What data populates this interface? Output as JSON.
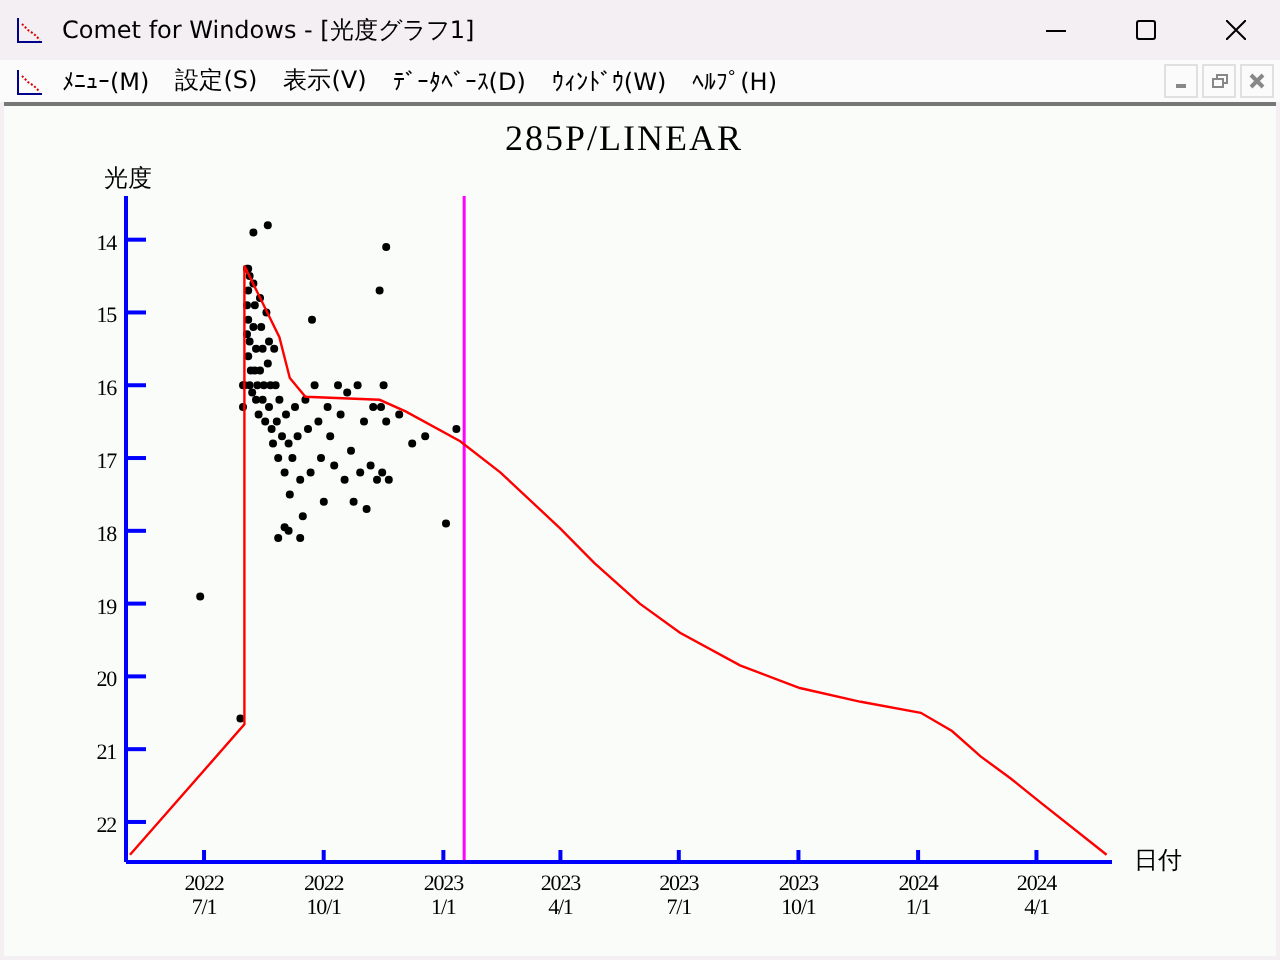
{
  "window": {
    "title": "Comet for Windows - [光度グラフ1]"
  },
  "menu": [
    "ﾒﾆｭｰ(M)",
    "設定(S)",
    "表示(V)",
    "ﾃﾞｰﾀﾍﾞｰｽ(D)",
    "ｳｨﾝﾄﾞｳ(W)",
    "ﾍﾙﾌﾟ(H)"
  ],
  "graph": {
    "chart_data": {
      "type": "scatter",
      "title": "285P/LINEAR",
      "xlabel": "日付",
      "ylabel": "光度",
      "xlim": [
        "2022-05-02",
        "2024-05-26"
      ],
      "ylim": [
        22.55,
        13.4
      ],
      "xticks": [
        {
          "value": "2022-07-01",
          "label": "2022\n7/1"
        },
        {
          "value": "2022-10-01",
          "label": "2022\n10/1"
        },
        {
          "value": "2023-01-01",
          "label": "2023\n1/1"
        },
        {
          "value": "2023-04-01",
          "label": "2023\n4/1"
        },
        {
          "value": "2023-07-01",
          "label": "2023\n7/1"
        },
        {
          "value": "2023-10-01",
          "label": "2023\n10/1"
        },
        {
          "value": "2024-01-01",
          "label": "2024\n1/1"
        },
        {
          "value": "2024-04-01",
          "label": "2024\n4/1"
        }
      ],
      "yticks": [
        14,
        15,
        16,
        17,
        18,
        19,
        20,
        21,
        22
      ],
      "series": [
        {
          "color": "#000000",
          "x": [
            "2022-07-31",
            "2022-07-31",
            "2022-08-01",
            "2022-08-03",
            "2022-08-04",
            "2022-08-05",
            "2022-08-04",
            "2022-08-03",
            "2022-08-04",
            "2022-08-03",
            "2022-08-05",
            "2022-08-04",
            "2022-08-06",
            "2022-08-05",
            "2022-08-07",
            "2022-08-08",
            "2022-08-09",
            "2022-08-08",
            "2022-08-10",
            "2022-08-09",
            "2022-08-11",
            "2022-08-10",
            "2022-08-12",
            "2022-08-13",
            "2022-08-14",
            "2022-08-15",
            "2022-08-13",
            "2022-08-16",
            "2022-08-15",
            "2022-08-17",
            "2022-08-18",
            "2022-08-20",
            "2022-08-19",
            "2022-08-21",
            "2022-08-20",
            "2022-08-22",
            "2022-08-24",
            "2022-08-25",
            "2022-08-23",
            "2022-08-26",
            "2022-08-28",
            "2022-08-27",
            "2022-08-30",
            "2022-09-01",
            "2022-09-02",
            "2022-09-04",
            "2022-09-05",
            "2022-09-07",
            "2022-09-09",
            "2022-09-11",
            "2022-09-13",
            "2022-09-15",
            "2022-09-17",
            "2022-09-19",
            "2022-09-21",
            "2022-09-22",
            "2022-09-24",
            "2022-09-27",
            "2022-09-29",
            "2022-10-01",
            "2022-10-04",
            "2022-10-06",
            "2022-10-09",
            "2022-10-12",
            "2022-10-14",
            "2022-10-17",
            "2022-10-19",
            "2022-10-22",
            "2022-10-24",
            "2022-10-27",
            "2022-10-29",
            "2022-11-01",
            "2022-11-03",
            "2022-11-06",
            "2022-11-08",
            "2022-11-11",
            "2022-11-13",
            "2022-11-14",
            "2022-11-15",
            "2022-11-16",
            "2022-11-18",
            "2022-11-18",
            "2022-11-20",
            "2022-11-28",
            "2022-12-08",
            "2022-12-18",
            "2023-01-03",
            "2023-01-11",
            "2022-08-19",
            "2022-08-08",
            "2022-06-28",
            "2022-07-29",
            "2022-08-27",
            "2022-09-01",
            "2022-09-13",
            "2022-09-04"
          ],
          "values": [
            16.0,
            16.3,
            16.0,
            14.4,
            14.4,
            14.5,
            14.7,
            14.9,
            15.1,
            15.3,
            15.4,
            15.6,
            15.8,
            16.0,
            16.1,
            14.6,
            14.9,
            15.2,
            15.5,
            15.8,
            16.0,
            16.2,
            16.4,
            14.8,
            15.2,
            15.5,
            15.8,
            16.0,
            16.2,
            16.5,
            15.0,
            15.4,
            15.7,
            16.0,
            16.3,
            16.6,
            15.5,
            16.0,
            16.8,
            16.5,
            16.2,
            17.0,
            16.7,
            17.2,
            16.4,
            16.8,
            17.5,
            17.0,
            16.3,
            16.7,
            17.3,
            17.8,
            16.2,
            16.6,
            17.2,
            15.1,
            16.0,
            16.5,
            17.0,
            17.6,
            16.3,
            16.7,
            17.1,
            16.0,
            16.4,
            17.3,
            16.1,
            16.9,
            17.6,
            16.0,
            17.2,
            16.5,
            17.7,
            17.1,
            16.3,
            17.3,
            14.7,
            16.3,
            17.2,
            16.0,
            14.1,
            16.5,
            17.3,
            16.4,
            16.8,
            16.7,
            17.9,
            16.6,
            13.8,
            13.9,
            18.9,
            20.58,
            18.1,
            17.95,
            18.1,
            18.0
          ]
        },
        {
          "type": "line",
          "color": "#ff0000",
          "x": [
            "2022-05-05",
            "2022-08-01",
            "2022-08-01",
            "2022-08-28",
            "2022-09-05",
            "2022-09-17",
            "2022-11-13",
            "2022-12-03",
            "2023-01-14",
            "2023-02-14",
            "2023-04-01",
            "2023-04-27",
            "2023-06-01",
            "2023-07-02",
            "2023-08-17",
            "2023-10-02",
            "2023-11-18",
            "2024-01-03",
            "2024-01-27",
            "2024-02-18",
            "2024-03-12",
            "2024-04-04",
            "2024-05-25"
          ],
          "values": [
            22.45,
            20.66,
            14.36,
            15.34,
            15.9,
            16.16,
            16.2,
            16.36,
            16.77,
            17.2,
            17.97,
            18.44,
            19.0,
            19.4,
            19.85,
            20.16,
            20.35,
            20.5,
            20.75,
            21.1,
            21.4,
            21.73,
            22.45
          ]
        }
      ],
      "ref_lines": [
        {
          "axis": "x",
          "value": "2023-01-17"
        }
      ]
    }
  }
}
